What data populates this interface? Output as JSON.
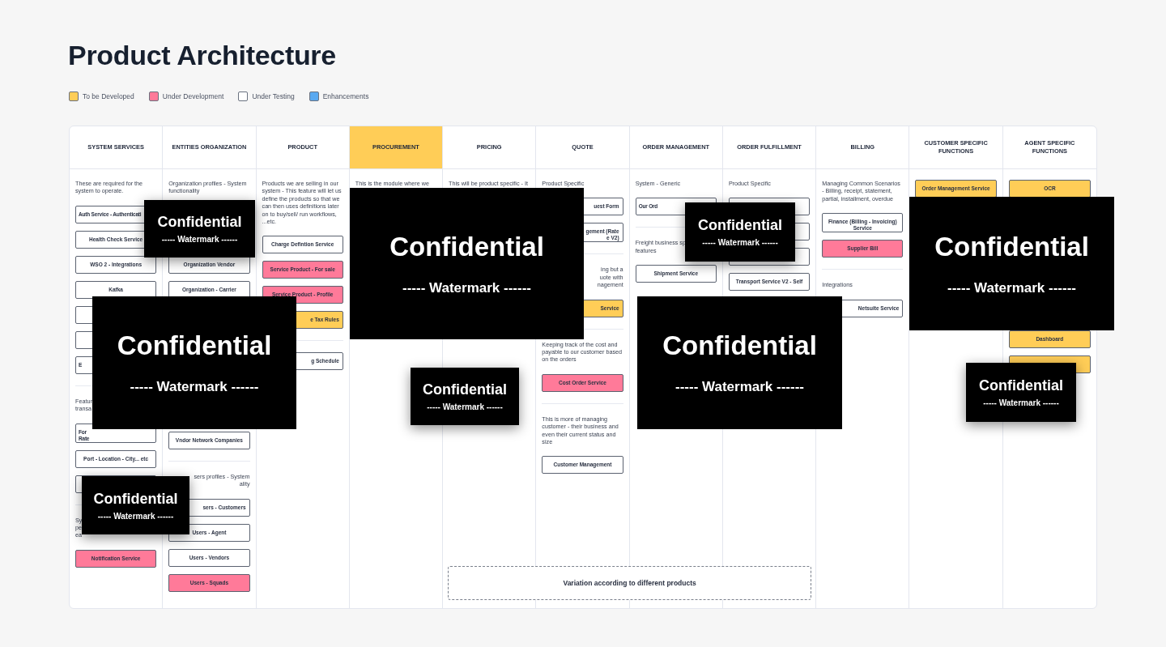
{
  "title": "Product Architecture",
  "legend": [
    {
      "label": "To be Developed",
      "color": "#ffcd57"
    },
    {
      "label": "Under Development",
      "color": "#ff7a99"
    },
    {
      "label": "Under Testing",
      "color": "#ffffff"
    },
    {
      "label": "Enhancements",
      "color": "#5aa9f0"
    }
  ],
  "columns": [
    {
      "title": "SYSTEM SERVICES",
      "highlight": false,
      "sections": [
        {
          "description": {
            "lines": [
              "These are required for the system to operate."
            ]
          },
          "items": [
            {
              "kind": "box",
              "color": "#ffffff",
              "lines": [
                "Auth Service - Authenticati"
              ],
              "tail_hidden": true
            },
            {
              "kind": "box",
              "color": "#ffffff",
              "lines": [
                "Health Check Service"
              ]
            },
            {
              "kind": "box",
              "color": "#ffffff",
              "lines": [
                "WSO 2 - Integrations"
              ]
            },
            {
              "kind": "box",
              "color": "#ffffff",
              "lines": [
                "Kafka"
              ]
            },
            {
              "kind": "box",
              "color": "#ffffff"
            },
            {
              "kind": "box",
              "color": "#ffffff"
            },
            {
              "kind": "box",
              "color": "#ffffff",
              "lines": [
                "E"
              ],
              "tail_hidden": true
            }
          ]
        },
        {
          "description": {
            "lines": [
              "Featur",
              "transa"
            ]
          },
          "items": [
            {
              "kind": "box",
              "color": "#ffffff",
              "lines": [
                "For",
                "Rate"
              ],
              "tail_hidden": true
            },
            {
              "kind": "box",
              "color": "#ffffff",
              "lines": [
                "Port - Location - City... etc"
              ]
            },
            {
              "kind": "box",
              "color": "#ffffff"
            }
          ]
        },
        {
          "description": {
            "lines": [
              "Sy",
              "pe",
              "ea"
            ]
          },
          "items": [
            {
              "kind": "box",
              "color": "#ff7a99",
              "lines": [
                "Notification Service"
              ]
            }
          ]
        }
      ]
    },
    {
      "title": "ENTITIES ORGANIZATION",
      "highlight": false,
      "sections": [
        {
          "description": {
            "lines": [
              "Organization profiles - System functionality"
            ]
          },
          "items": [
            {
              "kind": "covered"
            },
            {
              "kind": "covered"
            },
            {
              "kind": "box",
              "color": "#ffffff",
              "lines": [
                "Organization Vendor"
              ]
            },
            {
              "kind": "box",
              "color": "#ffffff",
              "lines": [
                "Organization - Carrier"
              ]
            },
            {
              "kind": "covered"
            },
            {
              "kind": "covered"
            },
            {
              "kind": "covered"
            },
            {
              "kind": "covered"
            },
            {
              "kind": "covered"
            },
            {
              "kind": "box",
              "color": "#ffffff",
              "lines": [
                "Vndor Network Companies"
              ]
            }
          ]
        },
        {
          "description": {
            "lines": [
              "sers profiles - System",
              "ality"
            ],
            "head_hidden": true
          },
          "items": [
            {
              "kind": "box",
              "color": "#ffffff",
              "lines": [
                "sers - Customers"
              ],
              "head_hidden": true
            },
            {
              "kind": "box",
              "color": "#ffffff",
              "lines": [
                "Users - Agent"
              ]
            },
            {
              "kind": "box",
              "color": "#ffffff",
              "lines": [
                "Users - Vendors"
              ]
            },
            {
              "kind": "box",
              "color": "#ff7a99",
              "lines": [
                "Users - Squads"
              ]
            }
          ]
        }
      ]
    },
    {
      "title": "PRODUCT",
      "highlight": false,
      "sections": [
        {
          "description": {
            "lines": [
              "Products we are selling in our system - This feature will let us define the products so that we can then uses definitions later on to buy/sell/ run workflows, ...etc."
            ]
          },
          "items": [
            {
              "kind": "box",
              "color": "#ffffff",
              "lines": [
                "Charge Defintion Service"
              ]
            },
            {
              "kind": "box",
              "color": "#ff7a99",
              "lines": [
                "Service Product - For sale"
              ]
            },
            {
              "kind": "box",
              "color": "#ff7a99",
              "lines": [
                "Service Product - Profile"
              ]
            },
            {
              "kind": "box",
              "color": "#ffcd57",
              "lines": [
                "e Tax Rules"
              ],
              "head_hidden": true
            }
          ]
        },
        {
          "items": [
            {
              "kind": "box",
              "color": "#ffffff",
              "lines": [
                "g Schedule"
              ],
              "head_hidden": true
            }
          ]
        }
      ]
    },
    {
      "title": "PROCUREMENT",
      "highlight": true,
      "sections": [
        {
          "description": {
            "lines": [
              "This is the module where we"
            ]
          }
        }
      ]
    },
    {
      "title": "PRICING",
      "highlight": false,
      "sections": [
        {
          "description": {
            "lines": [
              "This will be product specific - It"
            ]
          }
        }
      ]
    },
    {
      "title": "QUOTE",
      "highlight": false,
      "sections": [
        {
          "description": {
            "lines": [
              "Product Specific"
            ]
          },
          "items": [
            {
              "kind": "box",
              "color": "#ffffff",
              "lines": [
                "uest Form"
              ],
              "head_hidden": true
            },
            {
              "kind": "box",
              "color": "#ffffff",
              "lines": [
                "gement (Rate",
                "e V2)"
              ],
              "head_hidden": true
            }
          ]
        },
        {
          "description": {
            "lines": [
              "ing but a",
              "uote with",
              "nagement"
            ],
            "head_hidden": true
          },
          "items": [
            {
              "kind": "box",
              "color": "#ffcd57",
              "lines": [
                "Service"
              ],
              "head_hidden": true
            }
          ]
        },
        {
          "description": {
            "lines": [
              "Keeping track of the cost and payable to our customer based on the orders"
            ]
          },
          "items": [
            {
              "kind": "box",
              "color": "#ff7a99",
              "lines": [
                "Cost Order Service"
              ]
            }
          ]
        },
        {
          "description": {
            "lines": [
              "This is more of managing customer - their business and even their current status and size"
            ]
          },
          "items": [
            {
              "kind": "box",
              "color": "#ffffff",
              "lines": [
                "Customer Management"
              ]
            }
          ]
        }
      ]
    },
    {
      "title": "ORDER MANAGEMENT",
      "highlight": false,
      "sections": [
        {
          "description": {
            "lines": [
              "System - Generic"
            ]
          },
          "items": [
            {
              "kind": "box",
              "color": "#ffffff",
              "lines": [
                "Our Ord"
              ],
              "tail_hidden": true
            }
          ]
        },
        {
          "description": {
            "lines": [
              "Freight business sp",
              "features"
            ]
          },
          "items": [
            {
              "kind": "box",
              "color": "#ffffff",
              "lines": [
                "Shipment Service"
              ]
            }
          ]
        }
      ]
    },
    {
      "title": "ORDER FULFILLMENT",
      "highlight": false,
      "sections": [
        {
          "description": {
            "lines": [
              "Product Specific"
            ]
          },
          "items": [
            {
              "kind": "box",
              "color": "#ffffff"
            },
            {
              "kind": "box",
              "color": "#ffffff"
            },
            {
              "kind": "box",
              "color": "#ffffff"
            },
            {
              "kind": "box",
              "color": "#ffffff",
              "lines": [
                "Transport Service V2 - Self"
              ]
            }
          ]
        }
      ]
    },
    {
      "title": "BILLING",
      "highlight": false,
      "sections": [
        {
          "description": {
            "lines": [
              "Managing Common Scenarios - Billing, receipt, statement, partial, installment, overdue"
            ]
          },
          "items": [
            {
              "kind": "box",
              "color": "#ffffff",
              "lines": [
                "Finance (Billing - Invoicing) Service"
              ]
            },
            {
              "kind": "box",
              "color": "#ff7a99",
              "lines": [
                "Supplier Bill"
              ]
            }
          ]
        },
        {
          "description": {
            "lines": [
              "Integrations"
            ]
          },
          "items": [
            {
              "kind": "box",
              "color": "#ffffff",
              "lines": [
                "Netsuite Service"
              ],
              "head_hidden": true
            }
          ]
        }
      ]
    },
    {
      "title": "CUSTOMER SPECIFIC FUNCTIONS",
      "highlight": false,
      "sections": [
        {
          "items": [
            {
              "kind": "box",
              "color": "#ffcd57",
              "lines": [
                "Order Management Service"
              ]
            }
          ]
        }
      ]
    },
    {
      "title": "AGENT SPECIFIC FUNCTIONS",
      "highlight": false,
      "sections": [
        {
          "items": [
            {
              "kind": "box",
              "color": "#ffcd57",
              "lines": [
                "OCR"
              ]
            },
            {
              "kind": "covered"
            },
            {
              "kind": "covered"
            },
            {
              "kind": "covered"
            },
            {
              "kind": "covered"
            },
            {
              "kind": "covered"
            },
            {
              "kind": "box",
              "color": "#ffcd57",
              "lines": [
                "Dashboard"
              ]
            },
            {
              "kind": "box",
              "color": "#ffcd57"
            }
          ]
        }
      ]
    }
  ],
  "variation_note": "Variation according to different products",
  "overlays": [
    {
      "title": "Confidential",
      "subtitle": "----- Watermark ------"
    },
    {
      "title": "Confidential",
      "subtitle": "----- Watermark ------"
    },
    {
      "title": "Confidential",
      "subtitle": "----- Watermark ------"
    },
    {
      "title": "Confidential",
      "subtitle": "----- Watermark ------"
    },
    {
      "title": "Confidential",
      "subtitle": "----- Watermark ------"
    },
    {
      "title": "Confidential",
      "subtitle": "----- Watermark ------"
    },
    {
      "title": "Confidential",
      "subtitle": "----- Watermark ------"
    },
    {
      "title": "Confidential",
      "subtitle": "----- Watermark ------"
    },
    {
      "title": "Confidential",
      "subtitle": "----- Watermark ------"
    }
  ]
}
